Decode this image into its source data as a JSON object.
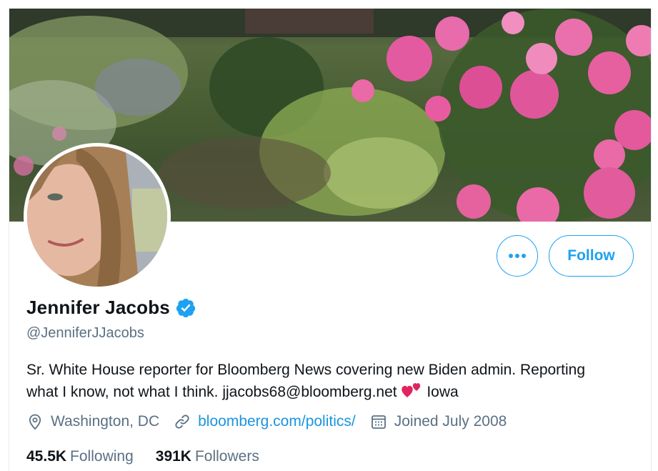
{
  "profile": {
    "name": "Jennifer Jacobs",
    "handle": "@JenniferJJacobs",
    "bio_line1": "Sr. White House reporter for Bloomberg News covering new Biden admin. Reporting",
    "bio_line2_before_emoji": "what I know, not what I think. jjacobs68@bloomberg.net",
    "bio_line2_after_emoji": "Iowa",
    "bio_emoji": "two-hearts-emoji",
    "verified": true
  },
  "actions": {
    "more_icon": "more-horizontal-icon",
    "follow_label": "Follow"
  },
  "meta": {
    "location": "Washington, DC",
    "website": "bloomberg.com/politics/",
    "joined": "Joined July 2008"
  },
  "stats": {
    "following_count": "45.5K",
    "following_label": "Following",
    "followers_count": "391K",
    "followers_label": "Followers"
  },
  "colors": {
    "accent": "#1da1f2",
    "link": "#1b95e0",
    "secondary_text": "#5b7083",
    "primary_text": "#0f1419",
    "emoji_heart": "#e0245e"
  }
}
